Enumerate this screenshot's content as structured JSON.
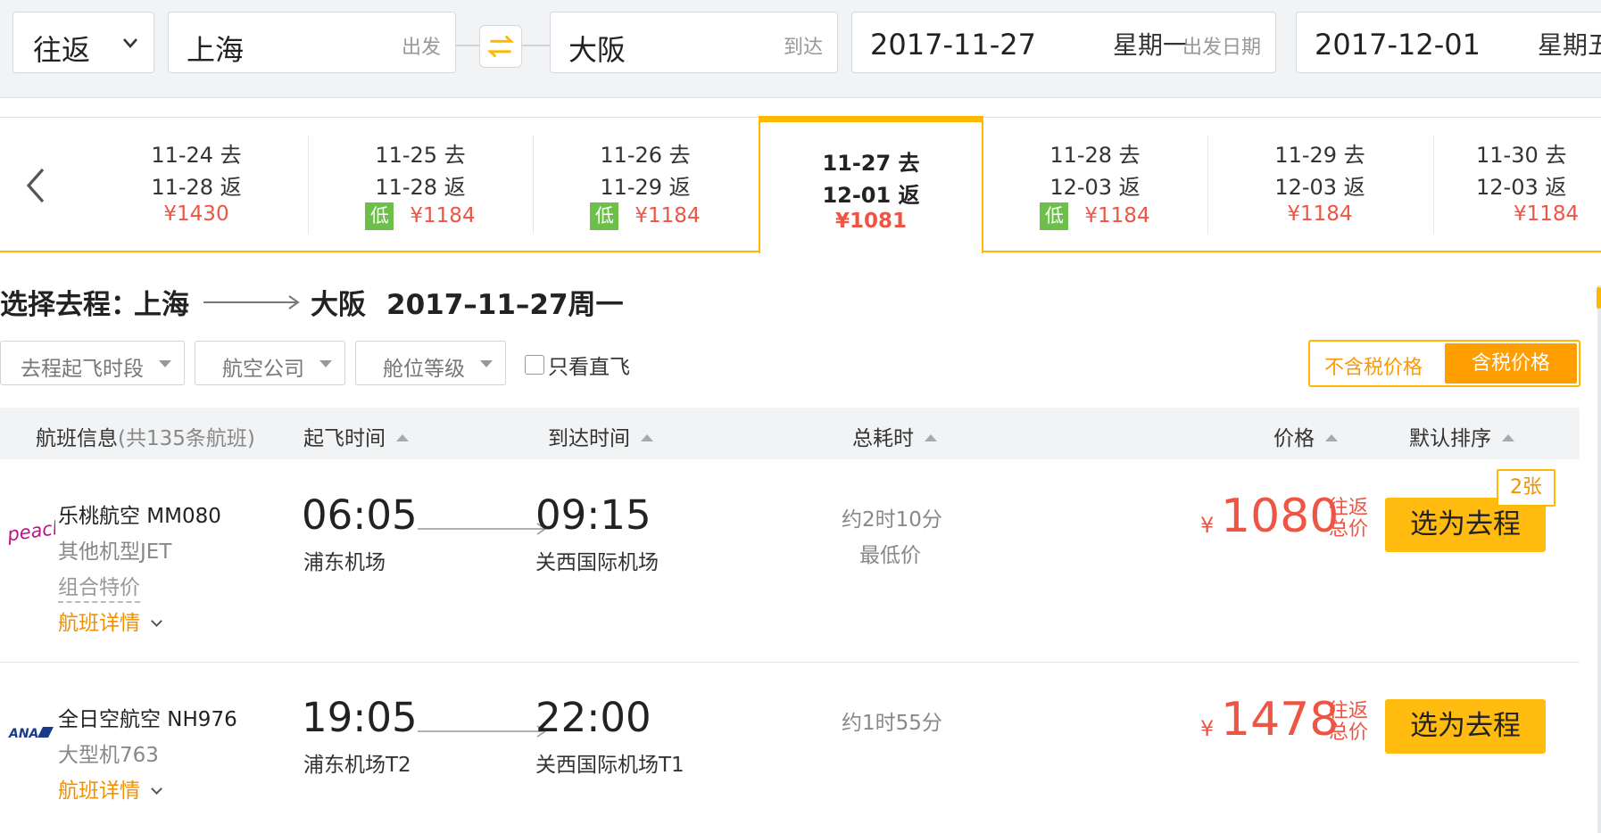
{
  "search": {
    "trip_type": "往返",
    "origin": "上海",
    "origin_hint": "出发",
    "destination": "大阪",
    "destination_hint": "到达",
    "depart_date": "2017-11-27",
    "depart_weekday": "星期一",
    "depart_hint": "出发日期",
    "return_date": "2017-12-01",
    "return_weekday": "星期五"
  },
  "date_strip": [
    {
      "depart": "11-24 去",
      "return": "11-28 返",
      "price": "¥1430",
      "low": false,
      "active": false
    },
    {
      "depart": "11-25 去",
      "return": "11-28 返",
      "price": "¥1184",
      "low": true,
      "active": false
    },
    {
      "depart": "11-26 去",
      "return": "11-29 返",
      "price": "¥1184",
      "low": true,
      "active": false
    },
    {
      "depart": "11-27 去",
      "return": "12-01 返",
      "price": "¥1081",
      "low": false,
      "active": true
    },
    {
      "depart": "11-28 去",
      "return": "12-03 返",
      "price": "¥1184",
      "low": true,
      "active": false
    },
    {
      "depart": "11-29 去",
      "return": "12-03 返",
      "price": "¥1184",
      "low": false,
      "active": false
    },
    {
      "depart": "11-30 去",
      "return": "12-03 返",
      "price": "¥1184",
      "low": false,
      "active": false
    }
  ],
  "low_badge": "低",
  "route": {
    "label": "选择去程：",
    "from": "上海",
    "to": "大阪",
    "date": "2017–11–27周一"
  },
  "filters": {
    "time_slot": "去程起飞时段",
    "airline": "航空公司",
    "cabin": "舱位等级",
    "direct_only": "只看直飞",
    "tax_excluded": "不含税价格",
    "tax_included": "含税价格"
  },
  "table_header": {
    "flight_info": "航班信息",
    "flight_count": "(共135条航班)",
    "depart_time": "起飞时间",
    "arrive_time": "到达时间",
    "duration": "总耗时",
    "price": "价格",
    "default_sort": "默认排序"
  },
  "flights": [
    {
      "logo": "peach",
      "airline": "乐桃航空 MM080",
      "plane": "其他机型JET",
      "combo": "组合特价",
      "details": "航班详情",
      "depart_time": "06:05",
      "depart_airport": "浦东机场",
      "arrive_time": "09:15",
      "arrive_airport": "关西国际机场",
      "duration": "约2时10分",
      "note": "最低价",
      "yen": "¥",
      "price": "1080",
      "rt_line1": "往返",
      "rt_line2": "总价",
      "select": "选为去程",
      "tickets": "2张"
    },
    {
      "logo": "ANA",
      "airline": "全日空航空 NH976",
      "plane": "大型机763",
      "details": "航班详情",
      "depart_time": "19:05",
      "depart_airport": "浦东机场T2",
      "arrive_time": "22:00",
      "arrive_airport": "关西国际机场T1",
      "duration": "约1时55分",
      "yen": "¥",
      "price": "1478",
      "rt_line1": "往返",
      "rt_line2": "总价",
      "select": "选为去程"
    }
  ],
  "colors": {
    "accent": "#ffb800",
    "price": "#ee5544",
    "low_badge": "#6cc04a",
    "details_link": "#f29100"
  },
  "icons": [
    "chevron-down-icon",
    "swap-icon",
    "chevron-left-icon",
    "route-arrow-icon",
    "caret-down-icon",
    "sort-up-icon",
    "flight-arrow-icon"
  ]
}
